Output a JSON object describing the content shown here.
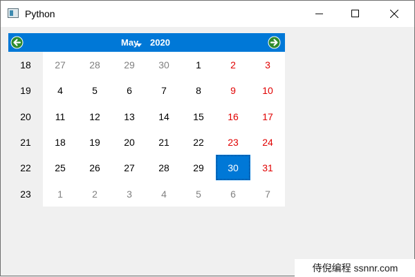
{
  "window": {
    "title": "Python"
  },
  "calendar": {
    "month": "May",
    "year": "2020",
    "weeks": [
      {
        "num": "18",
        "days": [
          {
            "d": "27",
            "type": "other"
          },
          {
            "d": "28",
            "type": "other"
          },
          {
            "d": "29",
            "type": "other"
          },
          {
            "d": "30",
            "type": "other"
          },
          {
            "d": "1",
            "type": "normal"
          },
          {
            "d": "2",
            "type": "weekend"
          },
          {
            "d": "3",
            "type": "weekend"
          }
        ]
      },
      {
        "num": "19",
        "days": [
          {
            "d": "4",
            "type": "normal"
          },
          {
            "d": "5",
            "type": "normal"
          },
          {
            "d": "6",
            "type": "normal"
          },
          {
            "d": "7",
            "type": "normal"
          },
          {
            "d": "8",
            "type": "normal"
          },
          {
            "d": "9",
            "type": "weekend"
          },
          {
            "d": "10",
            "type": "weekend"
          }
        ]
      },
      {
        "num": "20",
        "days": [
          {
            "d": "11",
            "type": "normal"
          },
          {
            "d": "12",
            "type": "normal"
          },
          {
            "d": "13",
            "type": "normal"
          },
          {
            "d": "14",
            "type": "normal"
          },
          {
            "d": "15",
            "type": "normal"
          },
          {
            "d": "16",
            "type": "weekend"
          },
          {
            "d": "17",
            "type": "weekend"
          }
        ]
      },
      {
        "num": "21",
        "days": [
          {
            "d": "18",
            "type": "normal"
          },
          {
            "d": "19",
            "type": "normal"
          },
          {
            "d": "20",
            "type": "normal"
          },
          {
            "d": "21",
            "type": "normal"
          },
          {
            "d": "22",
            "type": "normal"
          },
          {
            "d": "23",
            "type": "weekend"
          },
          {
            "d": "24",
            "type": "weekend"
          }
        ]
      },
      {
        "num": "22",
        "days": [
          {
            "d": "25",
            "type": "normal"
          },
          {
            "d": "26",
            "type": "normal"
          },
          {
            "d": "27",
            "type": "normal"
          },
          {
            "d": "28",
            "type": "normal"
          },
          {
            "d": "29",
            "type": "normal"
          },
          {
            "d": "30",
            "type": "selected"
          },
          {
            "d": "31",
            "type": "weekend"
          }
        ]
      },
      {
        "num": "23",
        "days": [
          {
            "d": "1",
            "type": "other"
          },
          {
            "d": "2",
            "type": "other"
          },
          {
            "d": "3",
            "type": "other"
          },
          {
            "d": "4",
            "type": "other"
          },
          {
            "d": "5",
            "type": "other"
          },
          {
            "d": "6",
            "type": "other"
          },
          {
            "d": "7",
            "type": "other"
          }
        ]
      }
    ]
  },
  "watermark": "侍倪编程 ssnnr.com",
  "colors": {
    "accent": "#0078d7",
    "weekend": "#e00000",
    "other_month": "#808080",
    "nav_arrow": "#2e8b2e"
  },
  "icons": {
    "prev": "arrow-left-icon",
    "next": "arrow-right-icon",
    "minimize": "minimize-icon",
    "maximize": "maximize-icon",
    "close": "close-icon"
  }
}
